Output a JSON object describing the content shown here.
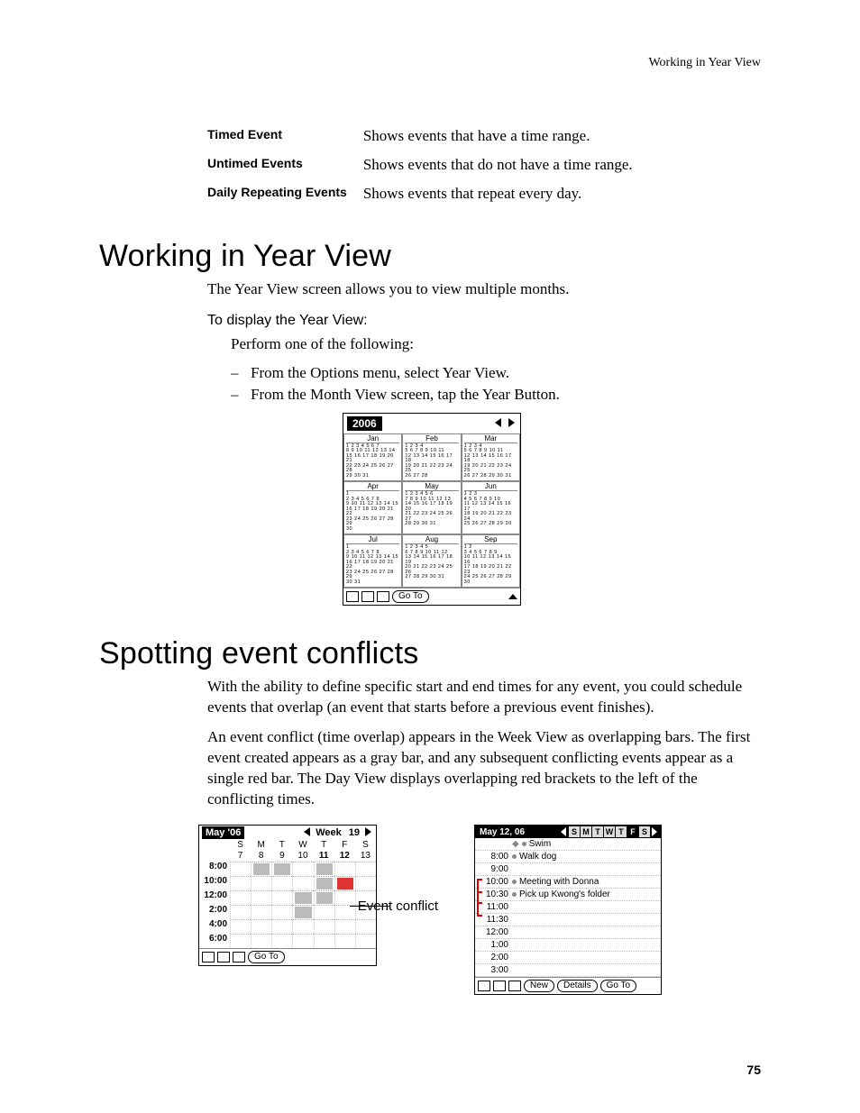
{
  "header": {
    "running_head": "Working in Year View"
  },
  "page_number": "75",
  "definitions": [
    {
      "term": "Timed Event",
      "desc": "Shows events that have a time range."
    },
    {
      "term": "Untimed Events",
      "desc": "Shows events that do not have a time range."
    },
    {
      "term": "Daily Repeating Events",
      "desc": "Shows events that repeat every day."
    }
  ],
  "year_section": {
    "heading": "Working in Year View",
    "intro": "The Year View screen allows you to view multiple months.",
    "subhead": "To display the Year View:",
    "lead": "Perform one of the following:",
    "steps": [
      "From the Options menu, select Year View.",
      "From the Month View screen, tap the Year Button."
    ]
  },
  "year_shot": {
    "year": "2006",
    "months": [
      "Jan",
      "Feb",
      "Mar",
      "Apr",
      "May",
      "Jun",
      "Jul",
      "Aug",
      "Sep"
    ],
    "go_to": "Go To"
  },
  "conflict_section": {
    "heading": "Spotting event conflicts",
    "p1": "With the ability to define specific start and end times for any event, you could schedule events that overlap (an event that starts before a previous event finishes).",
    "p2": "An event conflict (time overlap) appears in the Week View as overlapping bars. The first event created appears as a gray bar, and any subsequent conflicting events appear as a single red bar. The Day View displays overlapping red brackets to the left of the conflicting times."
  },
  "week_shot": {
    "title_month": "May '06",
    "week_label": "Week",
    "week_num": "19",
    "dows": [
      "S",
      "M",
      "T",
      "W",
      "T",
      "F",
      "S"
    ],
    "dates": [
      "7",
      "8",
      "9",
      "10",
      "11",
      "12",
      "13"
    ],
    "times": [
      "8:00",
      "10:00",
      "12:00",
      "2:00",
      "4:00",
      "6:00"
    ],
    "go_to": "Go To",
    "callout": "Event\nconflict"
  },
  "day_shot": {
    "date": "May 12, 06",
    "dows": [
      "S",
      "M",
      "T",
      "W",
      "T",
      "F",
      "S"
    ],
    "selected_index": 5,
    "rows": [
      {
        "time": "",
        "text": "Swim",
        "dot": true,
        "diamond": true
      },
      {
        "time": "8:00",
        "text": "Walk dog",
        "dot": true
      },
      {
        "time": "9:00",
        "text": ""
      },
      {
        "time": "10:00",
        "text": "Meeting with Donna",
        "dot": true
      },
      {
        "time": "10:30",
        "text": "Pick up Kwong's folder",
        "dot": true
      },
      {
        "time": "11:00",
        "text": ""
      },
      {
        "time": "11:30",
        "text": ""
      },
      {
        "time": "12:00",
        "text": ""
      },
      {
        "time": "1:00",
        "text": ""
      },
      {
        "time": "2:00",
        "text": ""
      },
      {
        "time": "3:00",
        "text": ""
      }
    ],
    "buttons": {
      "new": "New",
      "details": "Details",
      "goto": "Go To"
    }
  }
}
